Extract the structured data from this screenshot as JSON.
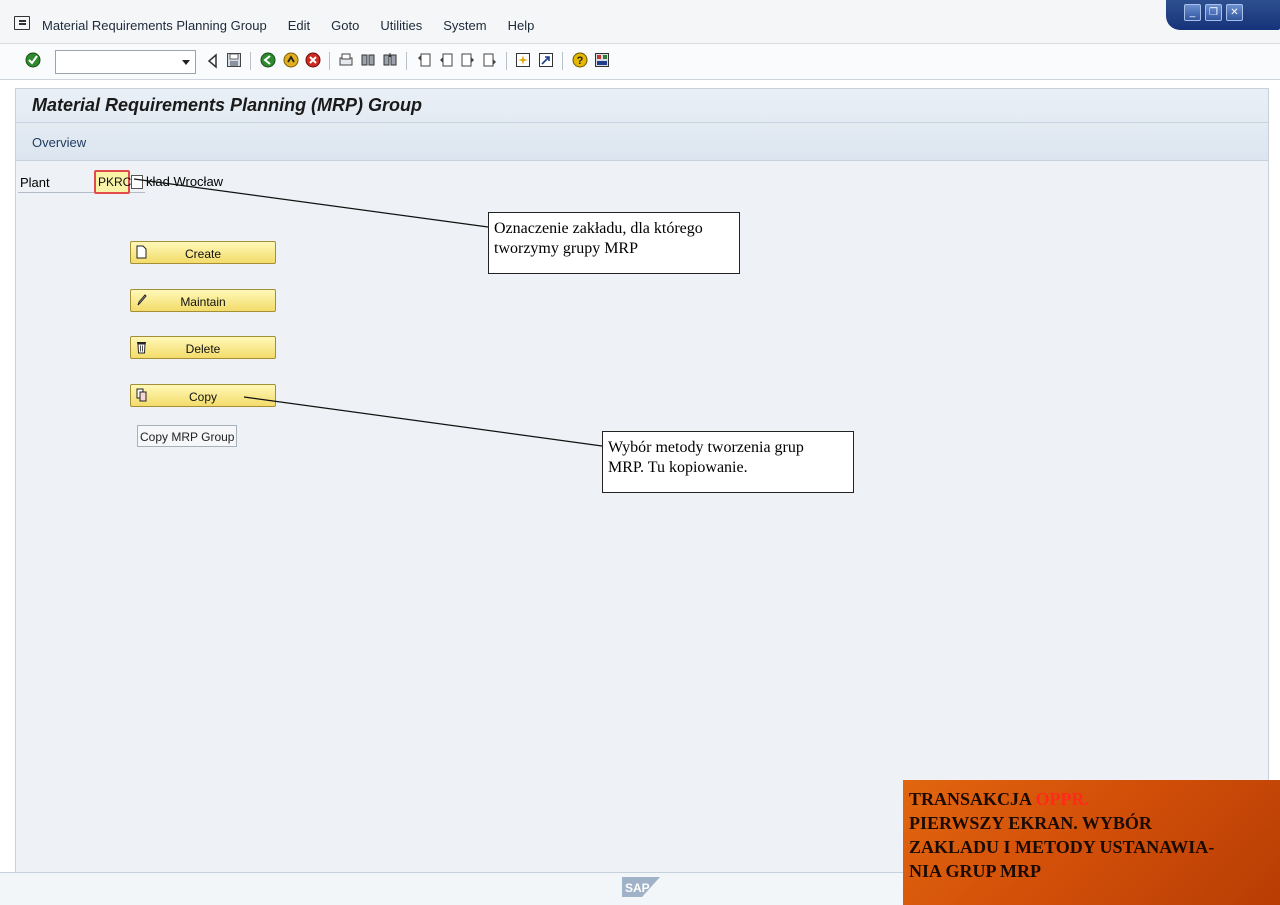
{
  "menubar": {
    "items": [
      "Material Requirements Planning Group",
      "Edit",
      "Goto",
      "Utilities",
      "System",
      "Help"
    ]
  },
  "toolbar": {
    "icons": [
      "enter-icon",
      "back-arrow-icon",
      "save-icon",
      "back-icon",
      "exit-icon",
      "cancel-icon",
      "print-icon",
      "find-icon",
      "find-next-icon",
      "first-page-icon",
      "previous-page-icon",
      "next-page-icon",
      "last-page-icon",
      "create-session-icon",
      "shortcut-icon",
      "help-icon",
      "layout-menu-icon"
    ]
  },
  "header": {
    "title": "Material Requirements Planning (MRP) Group",
    "tab": "Overview"
  },
  "form": {
    "plant_label": "Plant",
    "plant_value": "PKRC",
    "plant_name": "kład Wrocław"
  },
  "buttons": {
    "create": "Create",
    "maintain": "Maintain",
    "delete": "Delete",
    "copy": "Copy",
    "copy_tooltip": "Copy MRP Group"
  },
  "callouts": {
    "plant_note": [
      "Oznaczenie zakładu, dla którego",
      "tworzymy grupy MRP"
    ],
    "method_note": [
      "Wybór metody tworzenia grup",
      "MRP. Tu kopiowanie."
    ]
  },
  "banner": {
    "line1_prefix": "TRANSAKCJA",
    "line1_code": "OPPR.",
    "line2": "PIERWSZY EKRAN. WYBÓR",
    "line3": "ZAKLADU I METODY USTANAWIA-",
    "line4": "NIA GRUP MRP"
  },
  "footer": {
    "logo": "SAP"
  },
  "colors": {
    "accent": "#1f3f8a",
    "button": "#f3dc6a",
    "banner": "#d35009",
    "highlight": "#ff2a1a"
  }
}
